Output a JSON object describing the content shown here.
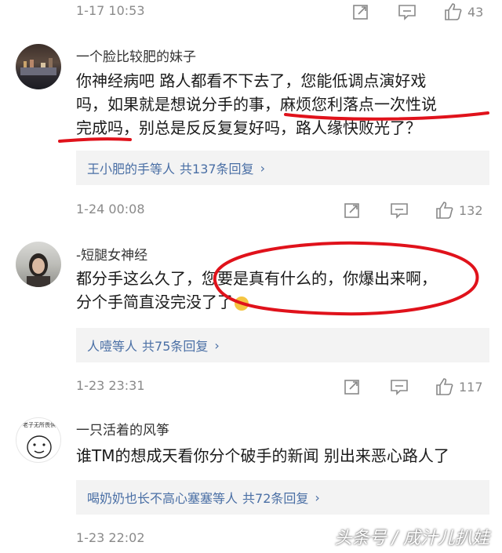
{
  "comments": [
    {
      "username": "一个脸比较肥的妹子",
      "body_lines": [
        "你神经病吧 路人都看不下去了，您能低调点演好戏",
        "吗，如果就是想说分手的事，麻烦您利落点一次性说",
        "完成吗，别总是反反复复好吗，路人缘快败光了？"
      ],
      "reply_names": "王小肥的手等人",
      "reply_count": "共137条回复",
      "timestamp": "1-24 00:08",
      "likes": "132"
    },
    {
      "username": "-短腿女神经",
      "body_lines": [
        "都分手这么久了，您要是真有什么的，你爆出来啊，",
        "分个手简直没完没了了"
      ],
      "reply_names": "人噎等人",
      "reply_count": "共75条回复",
      "timestamp": "1-23 23:31",
      "likes": "117"
    },
    {
      "username": "一只活着的风筝",
      "avatar_text": "老子无所畏惧",
      "body_lines": [
        "谁TM的想成天看你分个破手的新闻 别出来恶心路人了"
      ],
      "reply_names": "喝奶奶也长不高心塞塞等人",
      "reply_count": "共72条回复",
      "timestamp": "1-23 22:02",
      "likes": ""
    }
  ],
  "top_meta": {
    "timestamp": "1-17 10:53",
    "likes": "43"
  },
  "watermark": "头条号 / 成汁儿扒娃",
  "colors": {
    "link": "#4a6fa5",
    "highlight_red": "#e0121b"
  }
}
